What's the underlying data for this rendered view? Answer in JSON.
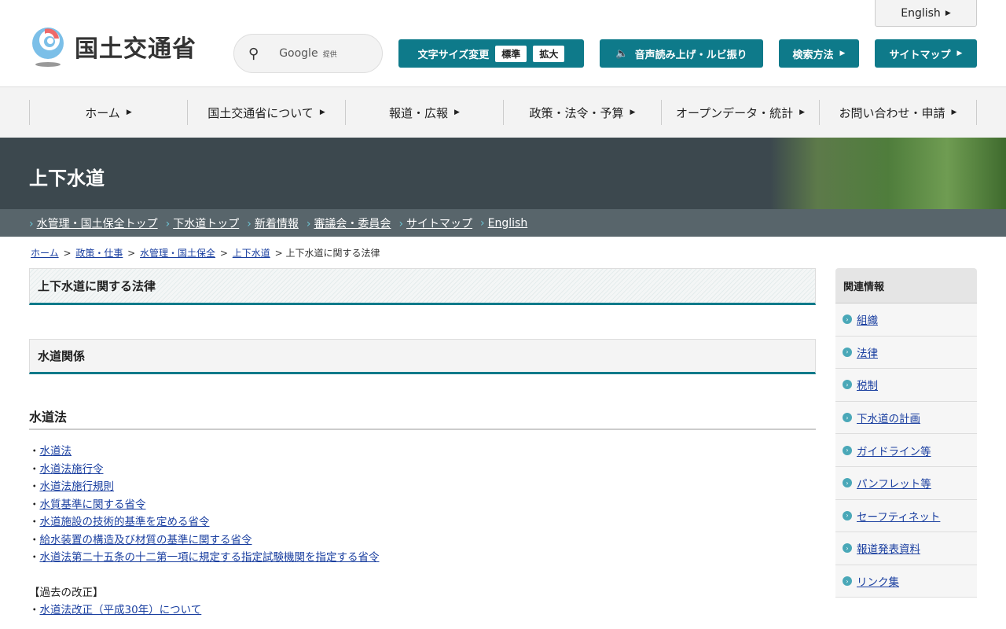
{
  "header": {
    "logo_text": "国土交通省",
    "search_provider": "Google",
    "search_suffix": "提供",
    "english": "English",
    "font_size_label": "文字サイズ変更",
    "font_standard": "標準",
    "font_large": "拡大",
    "speech": "音声読み上げ・ルビ振り",
    "search_method": "検索方法",
    "sitemap": "サイトマップ"
  },
  "nav": [
    "ホーム",
    "国土交通省について",
    "報道・広報",
    "政策・法令・予算",
    "オープンデータ・統計",
    "お問い合わせ・申請"
  ],
  "banner": {
    "title": "上下水道"
  },
  "subnav": [
    "水管理・国土保全トップ",
    "下水道トップ",
    "新着情報",
    "審議会・委員会",
    "サイトマップ",
    "English"
  ],
  "breadcrumb": {
    "items": [
      "ホーム",
      "政策・仕事",
      "水管理・国土保全",
      "上下水道"
    ],
    "current": "上下水道に関する法律"
  },
  "main": {
    "title": "上下水道に関する法律",
    "section": "水道関係",
    "subsection": "水道法",
    "links": [
      "水道法",
      "水道法施行令",
      "水道法施行規則",
      "水質基準に関する省令",
      "水道施設の技術的基準を定める省令",
      "給水装置の構造及び材質の基準に関する省令",
      "水道法第二十五条の十二第一項に規定する指定試験機関を指定する省令"
    ],
    "past_label": "【過去の改正】",
    "past_links": [
      "水道法改正（平成30年）について"
    ]
  },
  "sidebar": {
    "title": "関連情報",
    "items": [
      "組織",
      "法律",
      "税制",
      "下水道の計画",
      "ガイドライン等",
      "パンフレット等",
      "セーフティネット",
      "報道発表資料",
      "リンク集"
    ]
  },
  "colors": {
    "accent": "#0e7a8a",
    "banner": "#3c484e",
    "subnav": "#58656b"
  }
}
